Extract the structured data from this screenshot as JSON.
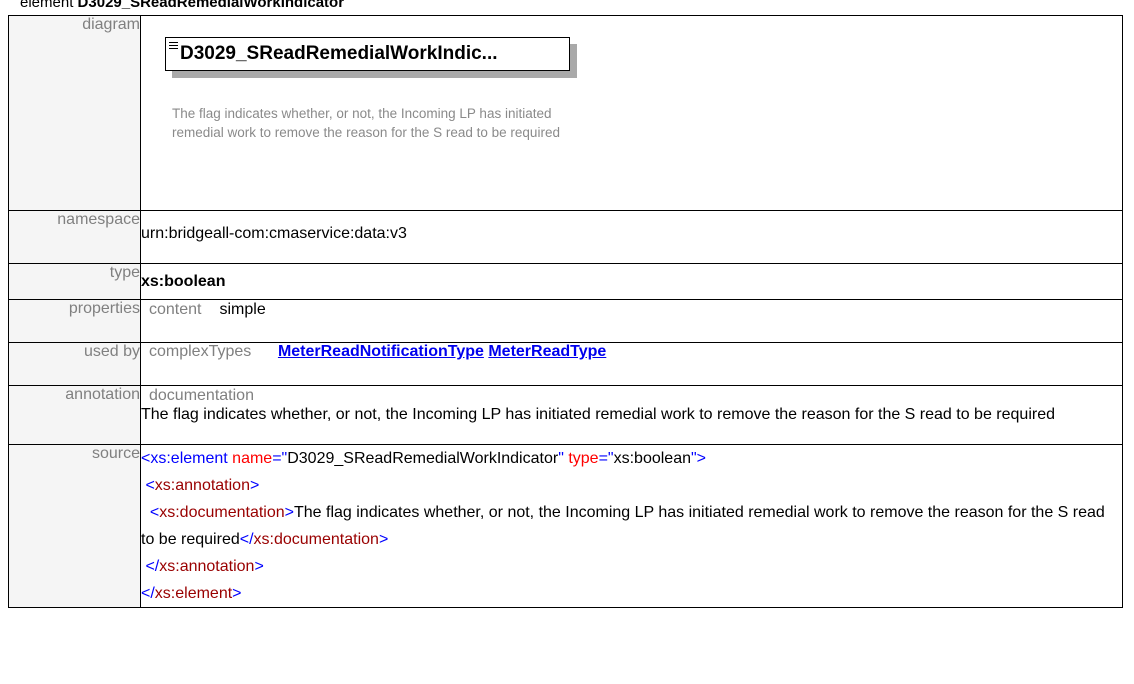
{
  "heading": {
    "prefix": "element ",
    "name": "D3029_SReadRemedialWorkIndicator"
  },
  "labels": {
    "diagram": "diagram",
    "namespace": "namespace",
    "type": "type",
    "properties": "properties",
    "used_by": "used by",
    "annotation": "annotation",
    "source": "source"
  },
  "diagram": {
    "box_label": "D3029_SReadRemedialWorkIndic...",
    "description": "The flag indicates whether, or not, the Incoming LP has initiated remedial work to remove the reason for the S read to be required"
  },
  "namespace": "urn:bridgeall-com:cmaservice:data:v3",
  "type": "xs:boolean",
  "properties": {
    "key": "content",
    "value": "simple"
  },
  "used_by": {
    "key": "complexTypes",
    "links": [
      "MeterReadNotificationType",
      "MeterReadType"
    ]
  },
  "annotation": {
    "key": "documentation",
    "text": "The flag indicates whether, or not, the Incoming LP has initiated remedial work to remove the reason for the S read to be required"
  },
  "source": {
    "open_tag": "<xs:element",
    "attr1_name": " name",
    "attr1_eq": "=\"",
    "attr1_val": "D3029_SReadRemedialWorkIndicator",
    "attr1_close": "\"",
    "attr2_name": " type",
    "attr2_eq": "=\"",
    "attr2_val": "xs:boolean",
    "attr2_close": "\">",
    "ann_open_lt": "<",
    "ann_open_name": "xs:annotation",
    "ann_open_gt": ">",
    "doc_open_lt": "<",
    "doc_open_name": "xs:documentation",
    "doc_open_gt": ">",
    "doc_text": "The flag indicates whether, or not, the Incoming LP has initiated remedial work to remove the reason for the S read to be required",
    "doc_close_lt": "</",
    "doc_close_name": "xs:documentation",
    "doc_close_gt": ">",
    "ann_close_lt": "</",
    "ann_close_name": "xs:annotation",
    "ann_close_gt": ">",
    "el_close_lt": "</",
    "el_close_name": "xs:element",
    "el_close_gt": ">"
  }
}
